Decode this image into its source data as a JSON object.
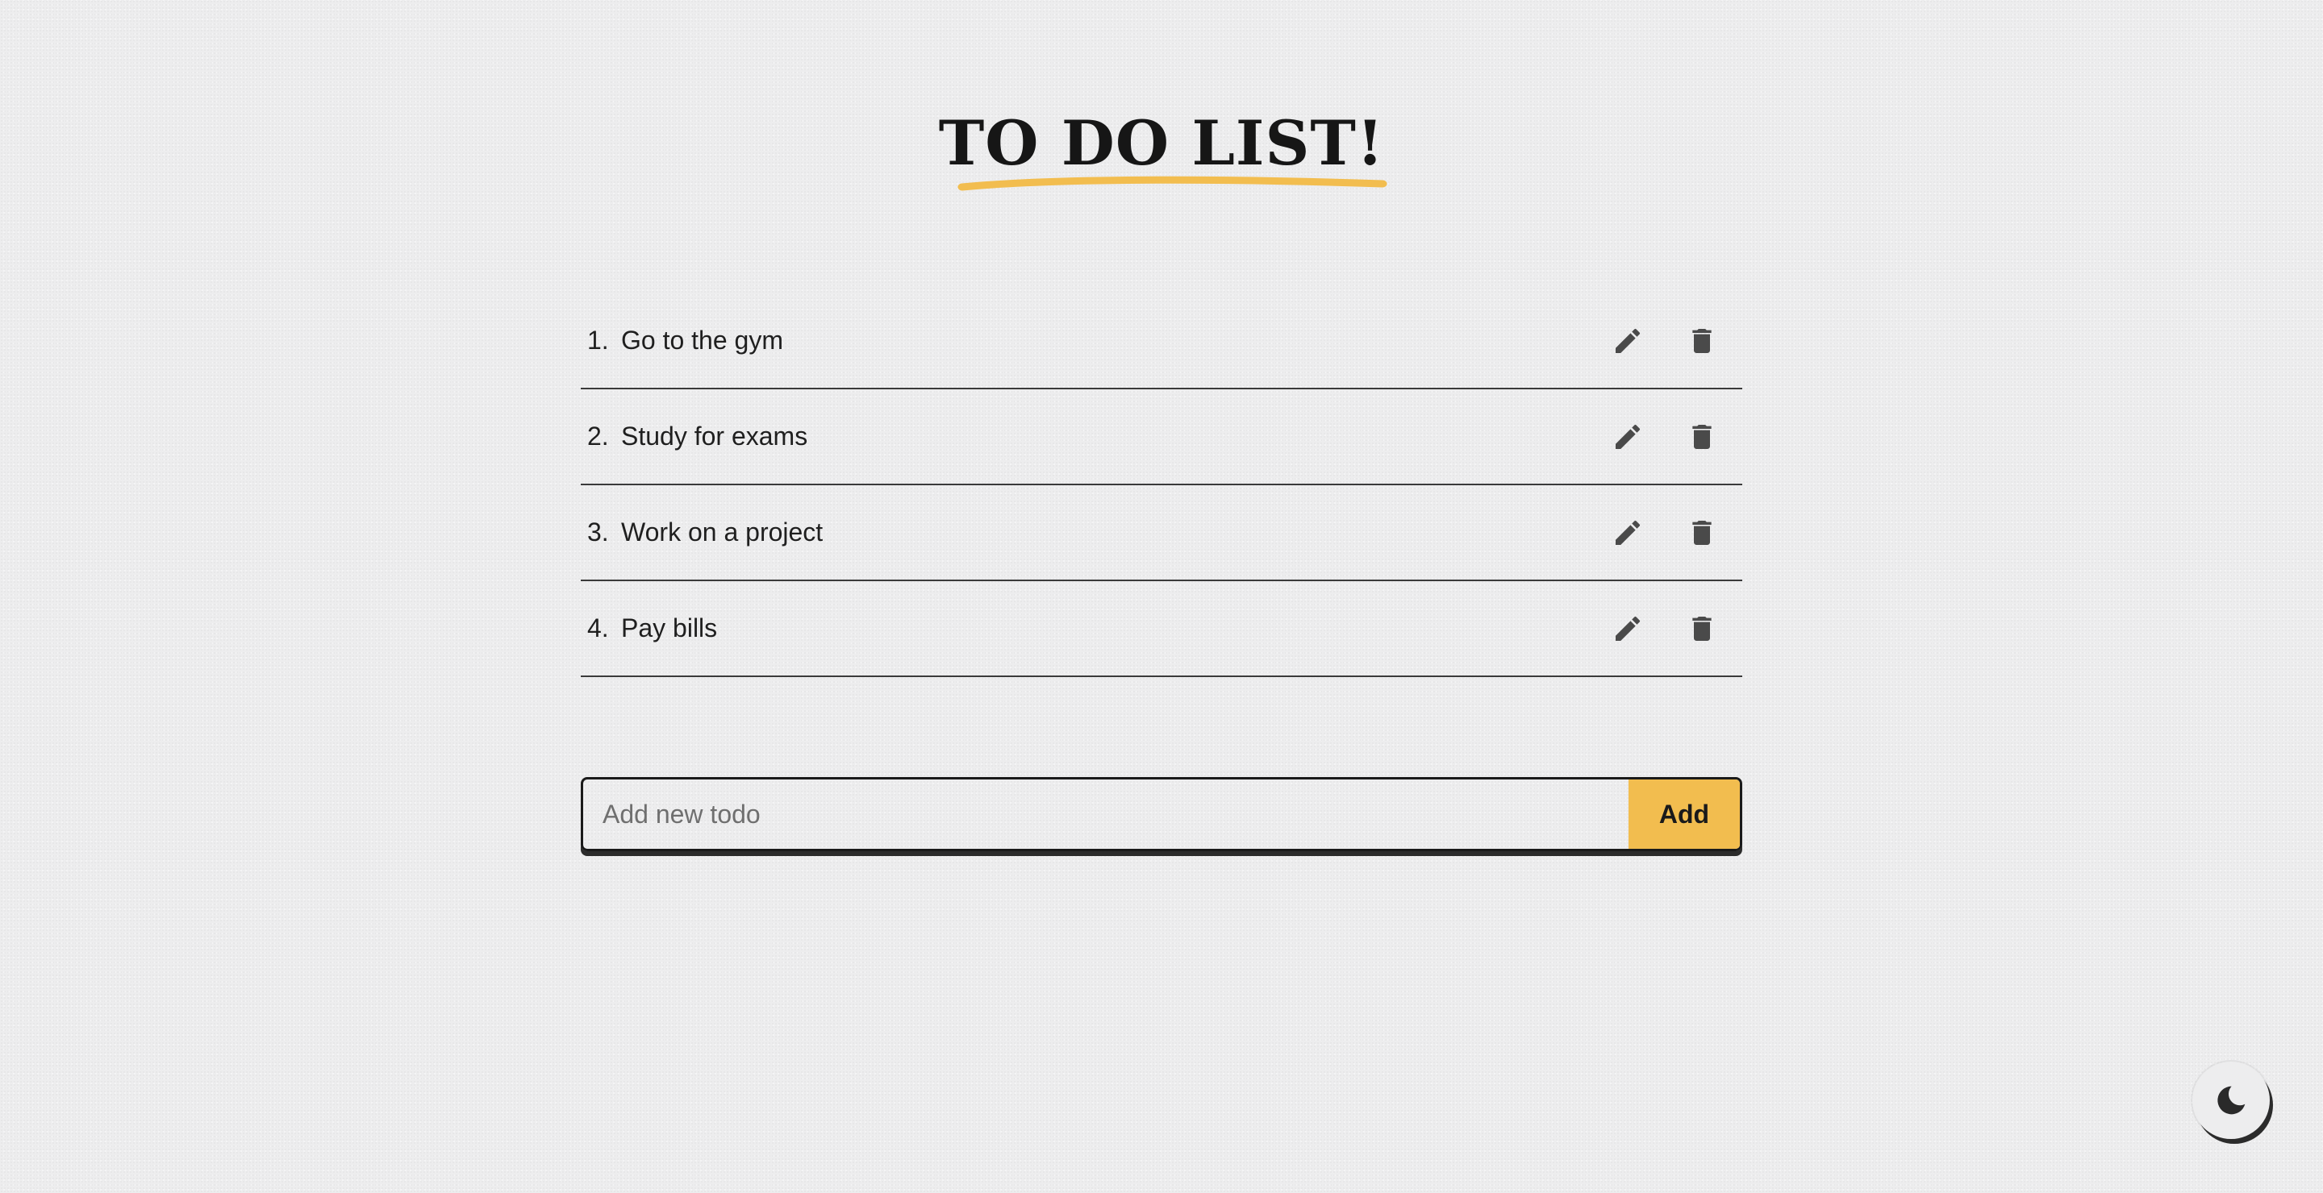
{
  "header": {
    "title": "TO DO LIST!",
    "underline_color": "#f2bd4f"
  },
  "todos": [
    {
      "number": "1.",
      "text": "Go to the gym"
    },
    {
      "number": "2.",
      "text": "Study for exams"
    },
    {
      "number": "3.",
      "text": "Work on a project"
    },
    {
      "number": "4.",
      "text": "Pay bills"
    }
  ],
  "icons": {
    "edit": "pencil-icon",
    "delete": "trash-icon",
    "theme": "moon-icon"
  },
  "add_form": {
    "placeholder": "Add new todo",
    "value": "",
    "button_label": "Add",
    "button_color": "#f2bd4f"
  }
}
